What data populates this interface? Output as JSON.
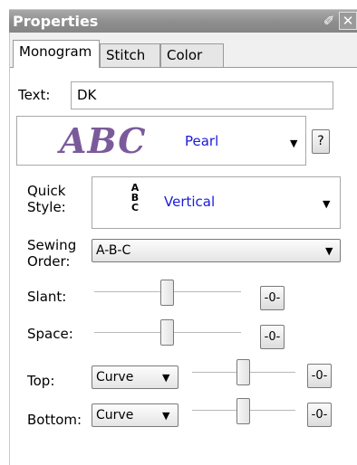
{
  "panel": {
    "title": "Properties",
    "pin_icon": "pin-icon",
    "close_icon": "close-icon"
  },
  "tabs": [
    {
      "label": "Monogram",
      "active": true
    },
    {
      "label": "Stitch",
      "active": false
    },
    {
      "label": "Color",
      "active": false
    }
  ],
  "text_field": {
    "label": "Text:",
    "value": "DK"
  },
  "font": {
    "preview": "ABC",
    "name": "Pearl",
    "help_label": "?"
  },
  "quick_style": {
    "label_line1": "Quick",
    "label_line2": "Style:",
    "preview_letters": [
      "A",
      "B",
      "C"
    ],
    "value": "Vertical"
  },
  "sewing_order": {
    "label_line1": "Sewing",
    "label_line2": "Order:",
    "value": "A-B-C"
  },
  "slant": {
    "label": "Slant:",
    "reset_label": "-0-",
    "level": 0.5
  },
  "space": {
    "label": "Space:",
    "reset_label": "-0-",
    "level": 0.5
  },
  "top": {
    "label": "Top:",
    "shape": "Curve",
    "reset_label": "-0-",
    "level": 0.5
  },
  "bottom": {
    "label": "Bottom:",
    "shape": "Curve",
    "reset_label": "-0-",
    "level": 0.5
  },
  "colors": {
    "font_link": "#1a1adc",
    "preview": "#7b5a9a",
    "title_bar": "#8e8e8e"
  }
}
